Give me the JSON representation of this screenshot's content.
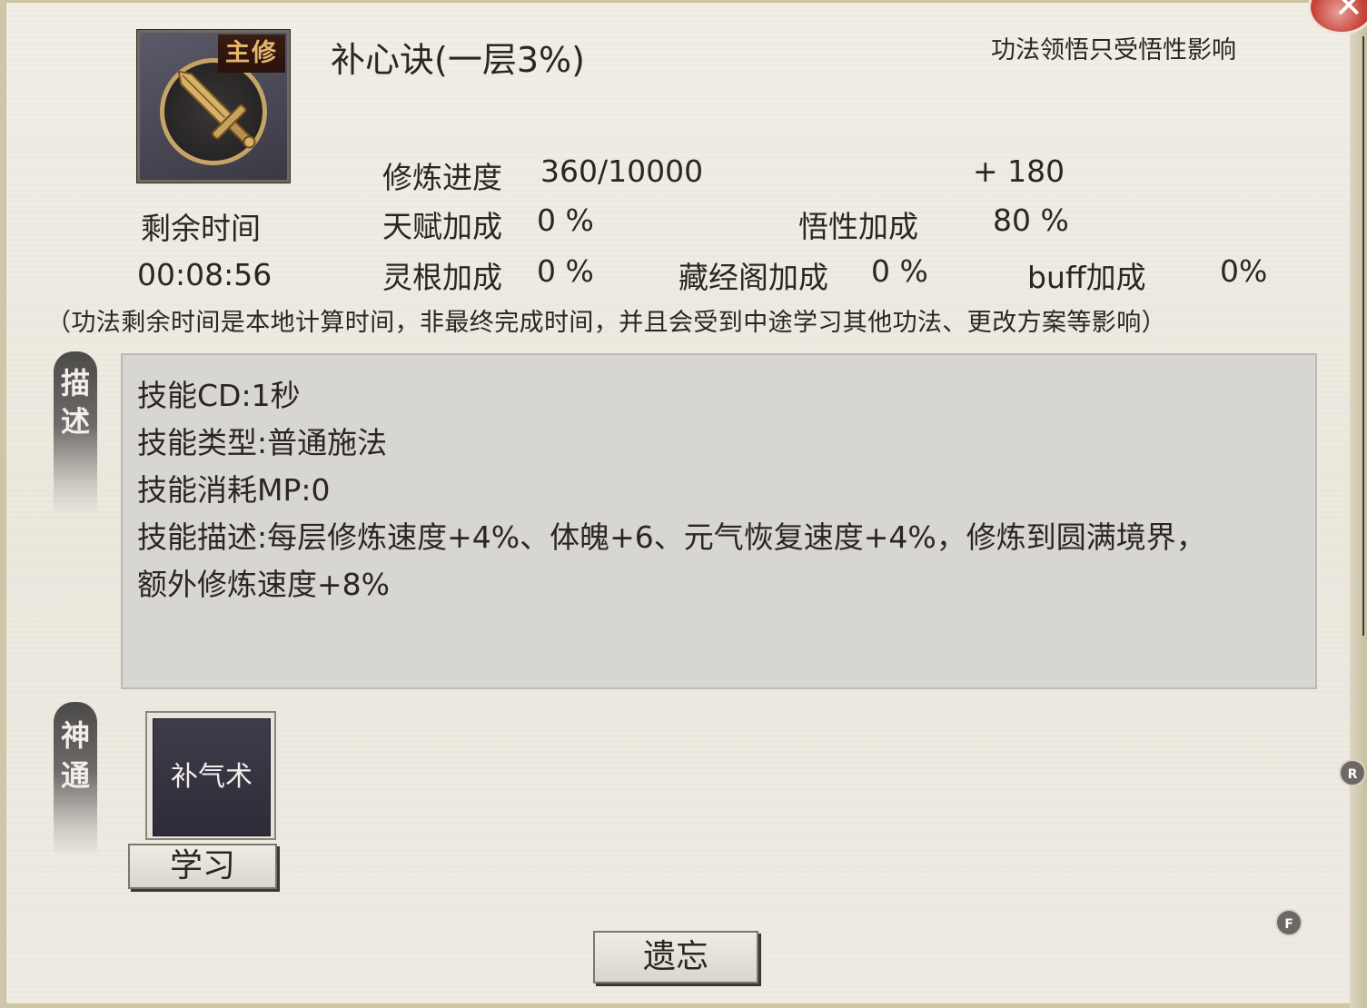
{
  "header": {
    "main_tag": "主修",
    "title": "补心诀(一层3%)",
    "hint": "功法领悟只受悟性影响"
  },
  "progress": {
    "label": "修炼进度",
    "value": "360/10000",
    "gain": "+ 180"
  },
  "remaining": {
    "label": "剩余时间",
    "time": "00:08:56"
  },
  "bonuses": {
    "talent_label": "天赋加成",
    "talent_value": "0 %",
    "comprehension_label": "悟性加成",
    "comprehension_value": "80 %",
    "root_label": "灵根加成",
    "root_value": "0 %",
    "library_label": "藏经阁加成",
    "library_value": "0 %",
    "buff_label": "buff加成",
    "buff_value": "0%"
  },
  "notice": "（功法剩余时间是本地计算时间，非最终完成时间，并且会受到中途学习其他功法、更改方案等影响）",
  "description": {
    "tab": [
      "描",
      "述"
    ],
    "lines": [
      "技能CD:1秒",
      "技能类型:普通施法",
      "技能消耗MP:0",
      "技能描述:每层修炼速度+4%、体魄+6、元气恢复速度+4%，修炼到圆满境界，",
      "额外修炼速度+8%"
    ]
  },
  "divine": {
    "tab": [
      "神",
      "通"
    ],
    "skill_name": "补气术",
    "learn_button": "学习"
  },
  "forget_button": "遗忘",
  "shortcuts": {
    "r": "R",
    "f": "F"
  },
  "colors": {
    "close": "#c8463c",
    "icon_gold": "#c6a467",
    "panel": "#eeebe3"
  },
  "icons": {
    "skill": "sword-icon",
    "close": "close-icon"
  }
}
